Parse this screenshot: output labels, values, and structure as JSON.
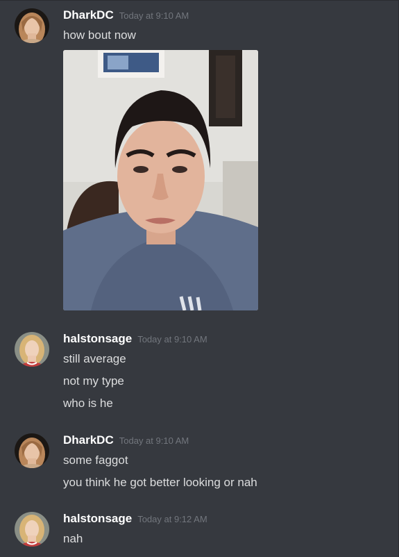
{
  "messages": [
    {
      "username": "DharkDC",
      "timestamp": "Today at 9:10 AM",
      "lines": [
        "how bout now"
      ],
      "attachment": "photo"
    },
    {
      "username": "halstonsage",
      "timestamp": "Today at 9:10 AM",
      "lines": [
        "still average",
        "not my type",
        "who is he"
      ]
    },
    {
      "username": "DharkDC",
      "timestamp": "Today at 9:10 AM",
      "lines": [
        "some faggot",
        "you think he got better looking or nah"
      ]
    },
    {
      "username": "halstonsage",
      "timestamp": "Today at 9:12 AM",
      "lines": [
        "nah"
      ]
    }
  ],
  "colors": {
    "background": "#36393f",
    "username": "#ffffff",
    "message_text": "#dcddde",
    "timestamp": "#72767d"
  }
}
